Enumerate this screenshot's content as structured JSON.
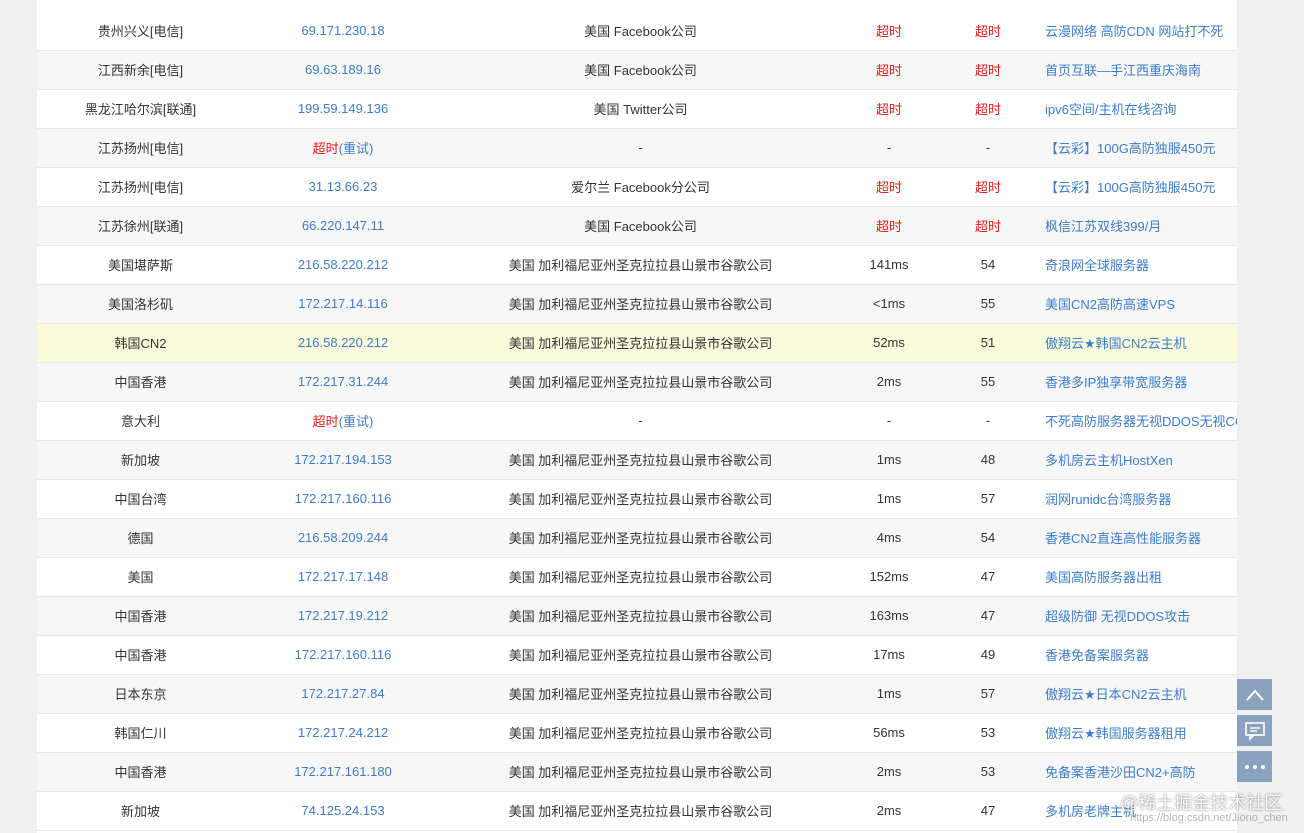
{
  "rows": [
    {
      "loc": "贵州兴义[电信]",
      "ip": "69.171.230.18",
      "geo": "美国 Facebook公司",
      "time": "超时",
      "ttl": "超时",
      "ad": "云漫网络 高防CDN 网站打不死",
      "status": "timeout-stats"
    },
    {
      "loc": "江西新余[电信]",
      "ip": "69.63.189.16",
      "geo": "美国 Facebook公司",
      "time": "超时",
      "ttl": "超时",
      "ad": "首页互联—手江西重庆海南",
      "status": "timeout-stats"
    },
    {
      "loc": "黑龙江哈尔滨[联通]",
      "ip": "199.59.149.136",
      "geo": "美国 Twitter公司",
      "time": "超时",
      "ttl": "超时",
      "ad": "ipv6空间/主机在线咨询",
      "status": "timeout-stats"
    },
    {
      "loc": "江苏扬州[电信]",
      "ip": "超时",
      "retry": "(重试)",
      "geo": "-",
      "time": "-",
      "ttl": "-",
      "ad": "【云彩】100G高防独服450元",
      "status": "timeout-ip"
    },
    {
      "loc": "江苏扬州[电信]",
      "ip": "31.13.66.23",
      "geo": "爱尔兰 Facebook分公司",
      "time": "超时",
      "ttl": "超时",
      "ad": "【云彩】100G高防独服450元",
      "status": "timeout-stats"
    },
    {
      "loc": "江苏徐州[联通]",
      "ip": "66.220.147.11",
      "geo": "美国 Facebook公司",
      "time": "超时",
      "ttl": "超时",
      "ad": "枫信江苏双线399/月",
      "status": "timeout-stats"
    },
    {
      "loc": "美国堪萨斯",
      "ip": "216.58.220.212",
      "geo": "美国 加利福尼亚州圣克拉拉县山景市谷歌公司",
      "time": "141ms",
      "ttl": "54",
      "ad": "奇浪网全球服务器",
      "status": "ok"
    },
    {
      "loc": "美国洛杉矶",
      "ip": "172.217.14.116",
      "geo": "美国 加利福尼亚州圣克拉拉县山景市谷歌公司",
      "time": "<1ms",
      "ttl": "55",
      "ad": "美国CN2高防高速VPS",
      "status": "ok"
    },
    {
      "loc": "韩国CN2",
      "ip": "216.58.220.212",
      "geo": "美国 加利福尼亚州圣克拉拉县山景市谷歌公司",
      "time": "52ms",
      "ttl": "51",
      "ad": "傲翔云★韩国CN2云主机",
      "status": "ok",
      "highlight": true
    },
    {
      "loc": "中国香港",
      "ip": "172.217.31.244",
      "geo": "美国 加利福尼亚州圣克拉拉县山景市谷歌公司",
      "time": "2ms",
      "ttl": "55",
      "ad": "香港多IP独享带宽服务器",
      "status": "ok"
    },
    {
      "loc": "意大利",
      "ip": "超时",
      "retry": "(重试)",
      "geo": "-",
      "time": "-",
      "ttl": "-",
      "ad": "不死高防服务器无视DDOS无视CC",
      "status": "timeout-ip"
    },
    {
      "loc": "新加坡",
      "ip": "172.217.194.153",
      "geo": "美国 加利福尼亚州圣克拉拉县山景市谷歌公司",
      "time": "1ms",
      "ttl": "48",
      "ad": "多机房云主机HostXen",
      "status": "ok"
    },
    {
      "loc": "中国台湾",
      "ip": "172.217.160.116",
      "geo": "美国 加利福尼亚州圣克拉拉县山景市谷歌公司",
      "time": "1ms",
      "ttl": "57",
      "ad": "润网runidc台湾服务器",
      "status": "ok"
    },
    {
      "loc": "德国",
      "ip": "216.58.209.244",
      "geo": "美国 加利福尼亚州圣克拉拉县山景市谷歌公司",
      "time": "4ms",
      "ttl": "54",
      "ad": "香港CN2直连高性能服务器",
      "status": "ok"
    },
    {
      "loc": "美国",
      "ip": "172.217.17.148",
      "geo": "美国 加利福尼亚州圣克拉拉县山景市谷歌公司",
      "time": "152ms",
      "ttl": "47",
      "ad": "美国高防服务器出租",
      "status": "ok"
    },
    {
      "loc": "中国香港",
      "ip": "172.217.19.212",
      "geo": "美国 加利福尼亚州圣克拉拉县山景市谷歌公司",
      "time": "163ms",
      "ttl": "47",
      "ad": "超级防御 无视DDOS攻击",
      "status": "ok"
    },
    {
      "loc": "中国香港",
      "ip": "172.217.160.116",
      "geo": "美国 加利福尼亚州圣克拉拉县山景市谷歌公司",
      "time": "17ms",
      "ttl": "49",
      "ad": "香港免备案服务器",
      "status": "ok"
    },
    {
      "loc": "日本东京",
      "ip": "172.217.27.84",
      "geo": "美国 加利福尼亚州圣克拉拉县山景市谷歌公司",
      "time": "1ms",
      "ttl": "57",
      "ad": "傲翔云★日本CN2云主机",
      "status": "ok"
    },
    {
      "loc": "韩国仁川",
      "ip": "172.217.24.212",
      "geo": "美国 加利福尼亚州圣克拉拉县山景市谷歌公司",
      "time": "56ms",
      "ttl": "53",
      "ad": "傲翔云★韩国服务器租用",
      "status": "ok"
    },
    {
      "loc": "中国香港",
      "ip": "172.217.161.180",
      "geo": "美国 加利福尼亚州圣克拉拉县山景市谷歌公司",
      "time": "2ms",
      "ttl": "53",
      "ad": "免备案香港沙田CN2+高防",
      "status": "ok"
    },
    {
      "loc": "新加坡",
      "ip": "74.125.24.153",
      "geo": "美国 加利福尼亚州圣克拉拉县山景市谷歌公司",
      "time": "2ms",
      "ttl": "47",
      "ad": "多机房老牌主机",
      "status": "ok"
    }
  ],
  "side_buttons": [
    {
      "icon": "chevron-up-icon"
    },
    {
      "icon": "comment-icon"
    },
    {
      "icon": "more-dots-icon"
    }
  ],
  "watermark": {
    "main": "@稀土掘金技术社区",
    "sub": "https://blog.csdn.net/Jiono_chen"
  },
  "colors": {
    "link": "#3d7cc9",
    "timeout": "#e0201a",
    "highlight_row": "#fafadc",
    "side_button": "#8aa2bd"
  }
}
